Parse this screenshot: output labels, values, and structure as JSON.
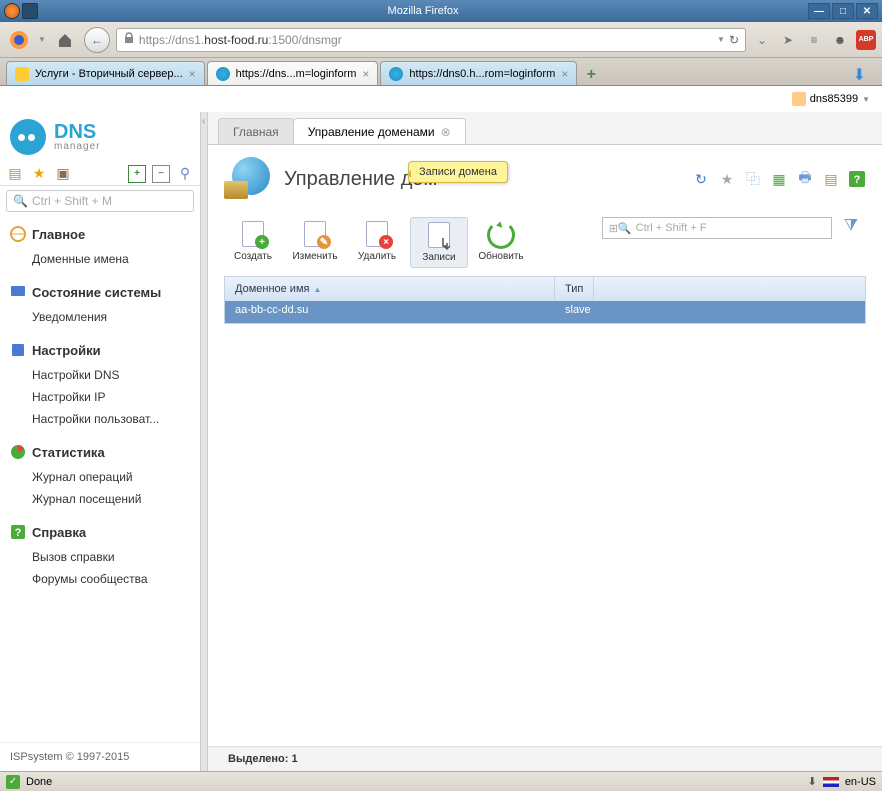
{
  "window": {
    "title": "Mozilla Firefox"
  },
  "browser": {
    "url_host": "https://dns1.",
    "url_mid": "host-food.ru",
    "url_tail": ":1500/dnsmgr",
    "tabs": [
      {
        "label": "Услуги - Вторичный сервер..."
      },
      {
        "label": "https://dns...m=loginform"
      },
      {
        "label": "https://dns0.h...rom=loginform"
      }
    ]
  },
  "user": {
    "name": "dns85399"
  },
  "logo": {
    "line1": "DNS",
    "line2": "manager"
  },
  "sidebar": {
    "search_placeholder": "Ctrl + Shift + M",
    "sections": [
      {
        "title": "Главное",
        "items": [
          "Доменные имена"
        ]
      },
      {
        "title": "Состояние системы",
        "items": [
          "Уведомления"
        ]
      },
      {
        "title": "Настройки",
        "items": [
          "Настройки DNS",
          "Настройки IP",
          "Настройки пользоват..."
        ]
      },
      {
        "title": "Статистика",
        "items": [
          "Журнал операций",
          "Журнал посещений"
        ]
      },
      {
        "title": "Справка",
        "items": [
          "Вызов справки",
          "Форумы сообщества"
        ]
      }
    ],
    "footer": "ISPsystem © 1997-2015"
  },
  "page_tabs": {
    "bg": "Главная",
    "fg": "Управление доменами"
  },
  "panel": {
    "title": "Управление дом",
    "tooltip": "Записи домена",
    "filter_placeholder": "Ctrl + Shift + F"
  },
  "actions": {
    "create": "Создать",
    "edit": "Изменить",
    "delete": "Удалить",
    "records": "Записи",
    "refresh": "Обновить"
  },
  "grid": {
    "col_domain": "Доменное имя",
    "col_type": "Тип",
    "rows": [
      {
        "domain": "aa-bb-cc-dd.su",
        "type": "slave"
      }
    ]
  },
  "status_selected": "Выделено: 1",
  "statusbar": {
    "done": "Done",
    "lang": "en-US"
  }
}
